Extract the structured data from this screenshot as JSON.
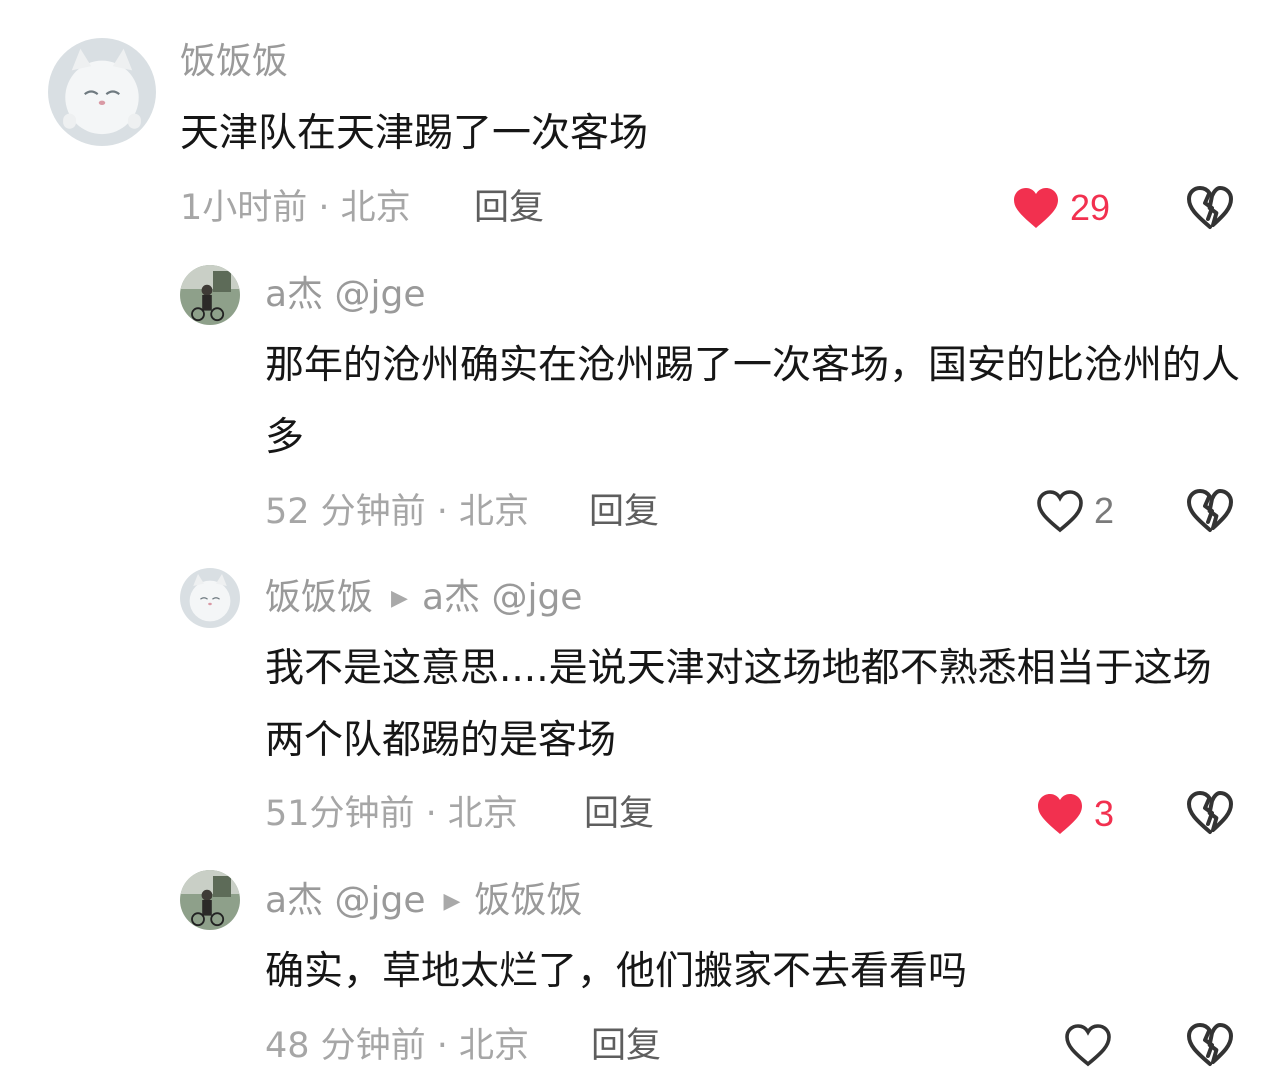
{
  "comments": [
    {
      "author": "饭饭饭",
      "reply_to": "",
      "text": "天津队在天津踢了一次客场",
      "time_location": "1小时前 · 北京",
      "reply_label": "回复",
      "likes": "29",
      "liked": true,
      "avatar_icon": "cat-avatar"
    },
    {
      "author": "a杰 @jge",
      "reply_to": "",
      "text": "那年的沧州确实在沧州踢了一次客场，国安的比沧州的人多",
      "time_location": "52 分钟前 · 北京",
      "reply_label": "回复",
      "likes": "2",
      "liked": false,
      "avatar_icon": "photo-avatar"
    },
    {
      "author": "饭饭饭",
      "reply_to": "a杰 @jge",
      "text": "我不是这意思....是说天津对这场地都不熟悉相当于这场两个队都踢的是客场",
      "time_location": "51分钟前 · 北京",
      "reply_label": "回复",
      "likes": "3",
      "liked": true,
      "avatar_icon": "cat-avatar"
    },
    {
      "author": "a杰 @jge",
      "reply_to": "饭饭饭",
      "text": "确实，草地太烂了，他们搬家不去看看吗",
      "time_location": "48 分钟前 · 北京",
      "reply_label": "回复",
      "likes": "",
      "liked": false,
      "avatar_icon": "photo-avatar"
    }
  ],
  "colors": {
    "like_active": "#f2304f",
    "meta_text": "#a6a6a6",
    "body_text": "#161616"
  }
}
